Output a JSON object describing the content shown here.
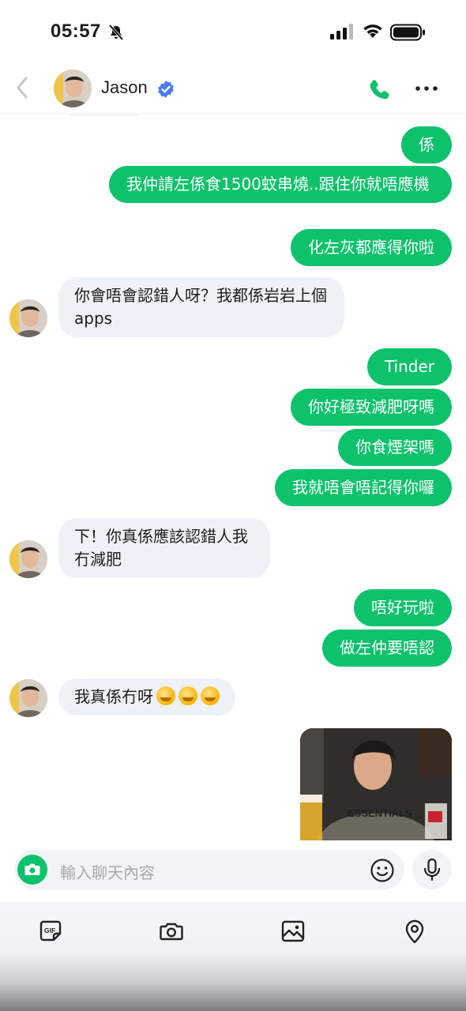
{
  "status_bar": {
    "time": "05:57",
    "icons": [
      "bell-slash-icon",
      "cellular-signal-icon",
      "wifi-icon",
      "battery-icon"
    ]
  },
  "header": {
    "contact_name": "Jason",
    "verified_icon": "verified-badge-icon",
    "accent": "#0dc26b",
    "actions": [
      "phone-call-icon",
      "more-icon"
    ]
  },
  "messages": [
    {
      "from": "me",
      "text": "係"
    },
    {
      "from": "me",
      "text": "我仲請左係食1500蚊串燒..跟住你就唔應機"
    },
    {
      "from": "me",
      "text": "化左灰都應得你啦"
    },
    {
      "from": "them",
      "text": "你會唔會認錯人呀？我都係岩岩上個apps"
    },
    {
      "from": "me",
      "text": "Tinder"
    },
    {
      "from": "me",
      "text": "你好極致減肥呀嗎"
    },
    {
      "from": "me",
      "text": "你食煙架嗎"
    },
    {
      "from": "me",
      "text": "我就唔會唔記得你囉"
    },
    {
      "from": "them",
      "text": "下！你真係應該認錯人我冇減肥"
    },
    {
      "from": "me",
      "text": "唔好玩啦"
    },
    {
      "from": "me",
      "text": "做左仲要唔認"
    },
    {
      "from": "them",
      "text": "我真係冇呀",
      "emoji": [
        "melting-face-emoji",
        "melting-face-emoji",
        "melting-face-emoji"
      ]
    },
    {
      "from": "me",
      "type": "photo",
      "photo_text": "ESSENTIALS"
    }
  ],
  "input": {
    "placeholder": "輸入聊天內容",
    "icons": [
      "camera-icon",
      "smiley-icon",
      "microphone-icon"
    ]
  },
  "toolbar": {
    "items": [
      "gif-icon",
      "camera-icon",
      "image-icon",
      "location-pin-icon"
    ],
    "gif_label": "GIF"
  }
}
